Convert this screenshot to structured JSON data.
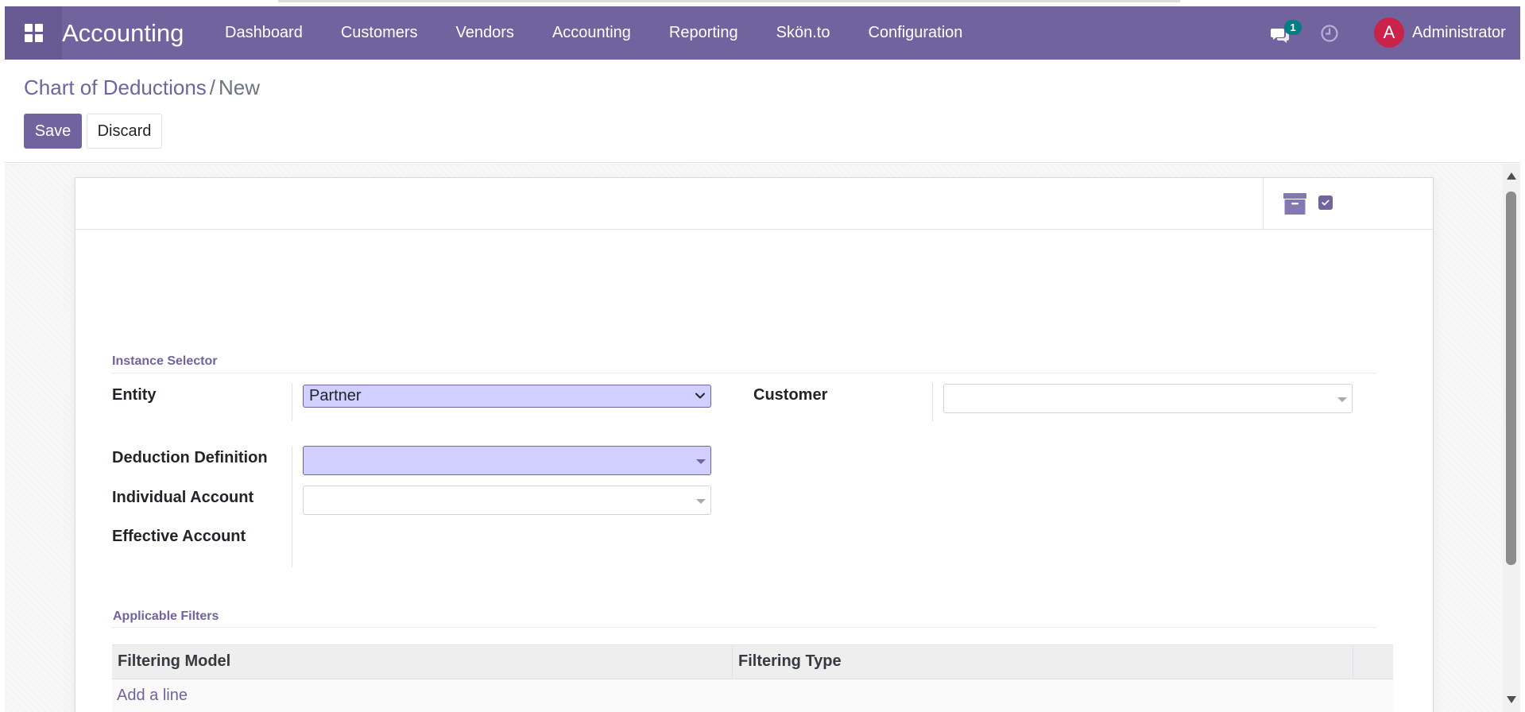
{
  "app": {
    "name": "Accounting"
  },
  "nav": {
    "menu": [
      "Dashboard",
      "Customers",
      "Vendors",
      "Accounting",
      "Reporting",
      "Skön.to",
      "Configuration"
    ],
    "messages_count": "1",
    "user_initial": "A",
    "user_name": "Administrator"
  },
  "breadcrumb": {
    "parent": "Chart of Deductions",
    "separator": "/",
    "current": "New"
  },
  "actions": {
    "save": "Save",
    "discard": "Discard"
  },
  "form": {
    "section_instance": "Instance Selector",
    "labels": {
      "entity": "Entity",
      "customer": "Customer",
      "deduction_definition": "Deduction Definition",
      "individual_account": "Individual Account",
      "effective_account": "Effective Account"
    },
    "values": {
      "entity": "Partner",
      "customer": "",
      "deduction_definition": "",
      "individual_account": "",
      "effective_account": ""
    },
    "section_filters": "Applicable Filters",
    "filters_table": {
      "columns": [
        "Filtering Model",
        "Filtering Type"
      ],
      "add_line": "Add a line"
    }
  },
  "colors": {
    "brand": "#71639e",
    "focus_field": "#d1cfff",
    "badge": "#017e84",
    "avatar": "#c9224b"
  },
  "icons": [
    "apps-grid-icon",
    "chat-icon",
    "clock-icon",
    "archive-icon",
    "checkbox-icon"
  ]
}
